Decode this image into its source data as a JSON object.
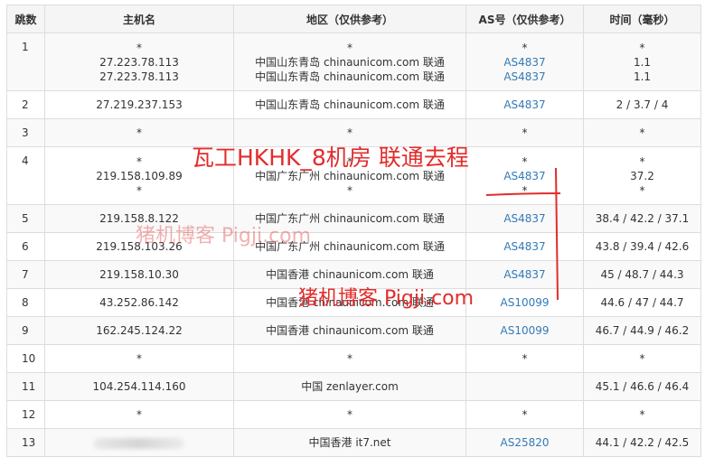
{
  "headers": [
    "跳数",
    "主机名",
    "地区（仅供参考）",
    "AS号（仅供参考）",
    "时间（毫秒）"
  ],
  "rows": [
    {
      "hop": "1",
      "hosts": [
        "*",
        "27.223.78.113",
        "27.223.78.113"
      ],
      "regions": [
        "*",
        "中国山东青岛 chinaunicom.com 联通",
        "中国山东青岛 chinaunicom.com 联通"
      ],
      "asns": [
        "*",
        "AS4837",
        "AS4837"
      ],
      "times": [
        "*",
        "1.1",
        "1.1"
      ]
    },
    {
      "hop": "2",
      "hosts": [
        "27.219.237.153"
      ],
      "regions": [
        "中国山东青岛 chinaunicom.com 联通"
      ],
      "asns": [
        "AS4837"
      ],
      "times": [
        "2 / 3.7 / 4"
      ]
    },
    {
      "hop": "3",
      "hosts": [
        "*"
      ],
      "regions": [
        "*"
      ],
      "asns": [
        "*"
      ],
      "times": [
        "*"
      ]
    },
    {
      "hop": "4",
      "hosts": [
        "*",
        "219.158.109.89",
        "*"
      ],
      "regions": [
        "*",
        "中国广东广州 chinaunicom.com 联通",
        "*"
      ],
      "asns": [
        "*",
        "AS4837",
        "*"
      ],
      "times": [
        "*",
        "37.2",
        "*"
      ]
    },
    {
      "hop": "5",
      "hosts": [
        "219.158.8.122"
      ],
      "regions": [
        "中国广东广州 chinaunicom.com 联通"
      ],
      "asns": [
        "AS4837"
      ],
      "times": [
        "38.4 / 42.2 / 37.1"
      ]
    },
    {
      "hop": "6",
      "hosts": [
        "219.158.103.26"
      ],
      "regions": [
        "中国广东广州 chinaunicom.com 联通"
      ],
      "asns": [
        "AS4837"
      ],
      "times": [
        "43.8 / 39.4 / 42.6"
      ]
    },
    {
      "hop": "7",
      "hosts": [
        "219.158.10.30"
      ],
      "regions": [
        "中国香港 chinaunicom.com 联通"
      ],
      "asns": [
        "AS4837"
      ],
      "times": [
        "45 / 48.7 / 44.3"
      ]
    },
    {
      "hop": "8",
      "hosts": [
        "43.252.86.142"
      ],
      "regions": [
        "中国香港 chinaunicom.com 联通"
      ],
      "asns": [
        "AS10099"
      ],
      "times": [
        "44.6 / 47 / 44.7"
      ]
    },
    {
      "hop": "9",
      "hosts": [
        "162.245.124.22"
      ],
      "regions": [
        "中国香港 chinaunicom.com 联通"
      ],
      "asns": [
        "AS10099"
      ],
      "times": [
        "46.7 / 44.9 / 46.2"
      ]
    },
    {
      "hop": "10",
      "hosts": [
        "*"
      ],
      "regions": [
        "*"
      ],
      "asns": [
        "*"
      ],
      "times": [
        "*"
      ]
    },
    {
      "hop": "11",
      "hosts": [
        "104.254.114.160"
      ],
      "regions": [
        "中国 zenlayer.com"
      ],
      "asns": [
        ""
      ],
      "times": [
        "45.1 / 46.6 / 46.4"
      ]
    },
    {
      "hop": "12",
      "hosts": [
        "*"
      ],
      "regions": [
        "*"
      ],
      "asns": [
        "*"
      ],
      "times": [
        "*"
      ]
    },
    {
      "hop": "13",
      "hosts": [
        ""
      ],
      "regions": [
        "中国香港 it7.net"
      ],
      "asns": [
        "AS25820"
      ],
      "times": [
        "44.1 / 42.2 / 42.5"
      ]
    }
  ],
  "overlay_title": "瓦工HKHK_8机房 联通去程",
  "watermark": "猪机博客 Pigji.com",
  "colors": {
    "annotation": "#e32c2c",
    "link": "#337ab7"
  }
}
